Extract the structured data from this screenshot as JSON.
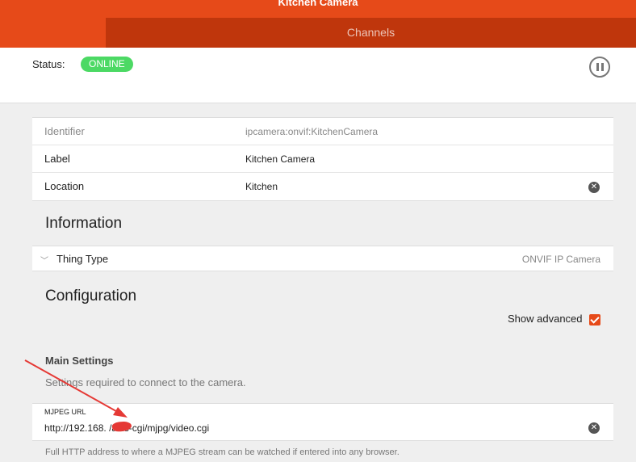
{
  "header": {
    "title": "Kitchen Camera",
    "tab_channels": "Channels",
    "accent": "#e64a19",
    "accent_dark": "#bf360c"
  },
  "status": {
    "label": "Status:",
    "badge": "ONLINE",
    "badge_color": "#4cd964",
    "pause_icon": "pause-icon"
  },
  "properties": [
    {
      "label": "Identifier",
      "value": "ipcamera:onvif:KitchenCamera"
    },
    {
      "label": "Label",
      "value": "Kitchen Camera"
    },
    {
      "label": "Location",
      "value": "Kitchen"
    }
  ],
  "information": {
    "title": "Information",
    "thing_type_label": "Thing Type",
    "thing_type_value": "ONVIF IP Camera"
  },
  "configuration": {
    "title": "Configuration",
    "show_advanced_label": "Show advanced",
    "show_advanced": true,
    "group_title": "Main Settings",
    "group_description": "Settings required to connect to the camera.",
    "mjpeg": {
      "label": "MJPEG URL",
      "value": "http://192.168.     /axis-cgi/mjpg/video.cgi",
      "hint": "Full HTTP address to where a MJPEG stream can be watched if entered into any browser."
    }
  },
  "annotation_color": "#e53935"
}
